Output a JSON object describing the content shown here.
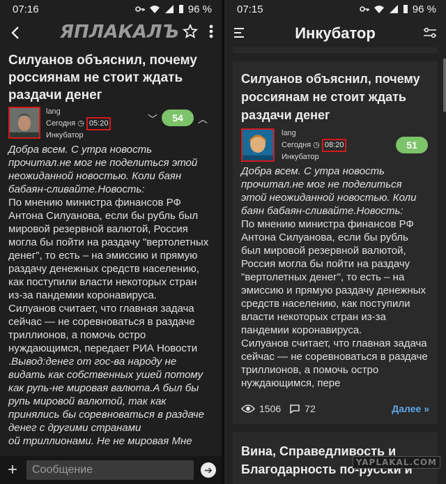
{
  "left": {
    "status": {
      "time": "07:16",
      "battery": "96 %"
    },
    "appbar": {
      "logo": "ЯПЛАКАЛЪ"
    },
    "article": {
      "title": "Силуанов объяснил, почему россиянам не стоит ждать раздачи денег",
      "author": "lang",
      "date_prefix": "Сегодня",
      "time": "05:20",
      "section": "Инкубатор",
      "rating": "54",
      "intro": "Добра всем. С утра новость прочитал.не мог не поделиться этой неожиданной новостью. Коли баян бабаян-сливайте.Новость:",
      "body": "По мнению министра финансов РФ Антона Силуанова, если бы рубль был мировой резервной валютой, Россия могла бы пойти на раздачу \"вертолетных денег\", то есть – на эмиссию и прямую раздачу денежных средств населению, как поступили власти некоторых стран из-за пандемии коронавируса.",
      "body2": "Силуанов считает, что главная задача сейчас — не соревноваться в раздаче триллионов, а помочь остро нуждающимся, передает РИА Новости .",
      "conclusion": "Вывод:денег от гос-ва народу не видать как собственных ушей потому как рупь-не мировая валюта.А был бы рупь мировой валютой, так как принялись бы соревноваться в раздаче денег с другими странами ",
      "conclusion_tail": "ой триллионами. Не не мировая Мне"
    },
    "composer": {
      "placeholder": "Сообщение"
    }
  },
  "right": {
    "status": {
      "time": "07:15",
      "battery": "96 %"
    },
    "appbar": {
      "title": "Инкубатор"
    },
    "card": {
      "title": "Силуанов объяснил, почему россиянам не стоит ждать раздачи денег",
      "author": "lang",
      "date_prefix": "Сегодня",
      "time": "08:20",
      "section": "Инкубатор",
      "rating": "51",
      "intro": "Добра всем. С утра новость прочитал.не мог не поделиться этой неожиданной новостью. Коли баян бабаян-сливайте.Новость:",
      "body": "По мнению министра финансов РФ Антона Силуанова, если бы рубль был мировой резервной валютой, Россия могла бы пойти на раздачу \"вертолетных денег\", то есть – на эмиссию и прямую раздачу денежных средств населению, как поступили власти некоторых стран из-за пандемии коронавируса.",
      "body2": "Силуанов считает, что главная задача сейчас — не соревноваться в раздаче триллионов, а помочь остро нуждающимся, пере",
      "views": "1506",
      "comments": "72",
      "more": "Далее »"
    },
    "next_card": {
      "title": "Вина, Справедливость и Благодарность по-русски и по-западному сегодня и"
    },
    "watermark": "YAPLAKAL.COM"
  },
  "colors": {
    "rating_green": "#7cc36a",
    "highlight_red": "#d21a1a",
    "link_blue": "#5ea8e8"
  }
}
